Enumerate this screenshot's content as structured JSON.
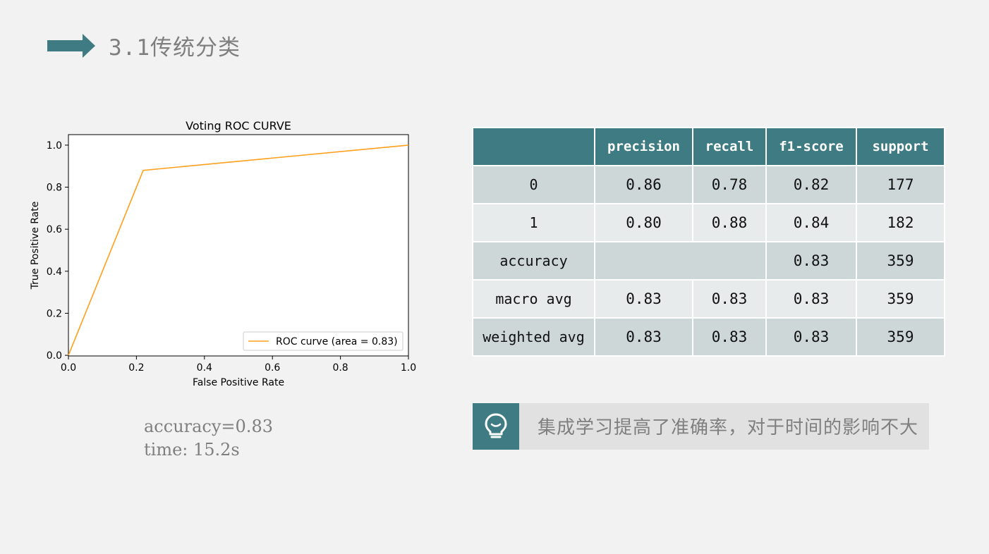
{
  "header": {
    "title": "3.1传统分类",
    "accent_color": "#3e7b83",
    "icon": "right-arrow-icon"
  },
  "chart_data": {
    "type": "line",
    "title": "Voting ROC CURVE",
    "xlabel": "False Positive Rate",
    "ylabel": "True Positive Rate",
    "xlim": [
      0.0,
      1.0
    ],
    "ylim": [
      0.0,
      1.0
    ],
    "x_ticks": [
      "0.0",
      "0.2",
      "0.4",
      "0.6",
      "0.8",
      "1.0"
    ],
    "y_ticks": [
      "0.0",
      "0.2",
      "0.4",
      "0.6",
      "0.8",
      "1.0"
    ],
    "grid": false,
    "legend_position": "lower-right",
    "series": [
      {
        "name": "ROC curve (area = 0.83)",
        "color": "#ff9f1c",
        "x": [
          0.0,
          0.22,
          1.0
        ],
        "y": [
          0.0,
          0.88,
          1.0
        ]
      }
    ]
  },
  "metrics": {
    "accuracy": "accuracy=0.83",
    "time": "time: 15.2s"
  },
  "report": {
    "headers": [
      "",
      "precision",
      "recall",
      "f1-score",
      "support"
    ],
    "rows": [
      {
        "label": "0",
        "precision": "0.86",
        "recall": "0.78",
        "f1": "0.82",
        "support": "177"
      },
      {
        "label": "1",
        "precision": "0.80",
        "recall": "0.88",
        "f1": "0.84",
        "support": "182"
      },
      {
        "label": "accuracy",
        "precision": "",
        "recall": "",
        "f1": "0.83",
        "support": "359"
      },
      {
        "label": "macro avg",
        "precision": "0.83",
        "recall": "0.83",
        "f1": "0.83",
        "support": "359"
      },
      {
        "label": "weighted avg",
        "precision": "0.83",
        "recall": "0.83",
        "f1": "0.83",
        "support": "359"
      }
    ]
  },
  "note": {
    "icon": "lightbulb-icon",
    "text": "集成学习提高了准确率，对于时间的影响不大"
  }
}
